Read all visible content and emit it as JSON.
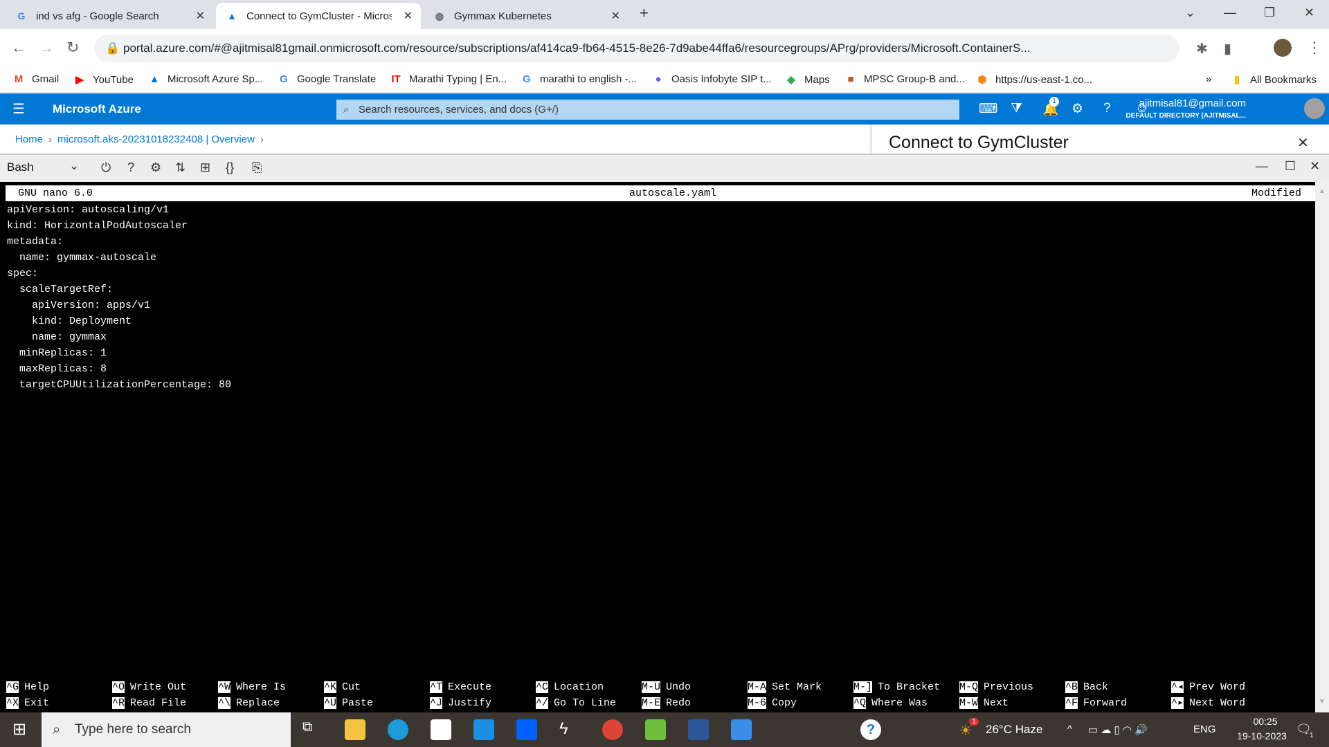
{
  "browser": {
    "tabs": [
      {
        "label": "ind vs afg - Google Search",
        "icon": "google-icon"
      },
      {
        "label": "Connect to GymCluster - Microso",
        "icon": "azure-icon"
      },
      {
        "label": "Gymmax Kubernetes",
        "icon": "globe-icon"
      }
    ],
    "url": "portal.azure.com/#@ajitmisal81gmail.onmicrosoft.com/resource/subscriptions/af414ca9-fb64-4515-8e26-7d9abe44ffa6/resourcegroups/APrg/providers/Microsoft.ContainerS...",
    "bookmarks": [
      "Gmail",
      "YouTube",
      "Microsoft Azure Sp...",
      "Google Translate",
      "Marathi Typing | En...",
      "marathi to english -...",
      "Oasis Infobyte SIP t...",
      "Maps",
      "MPSC Group-B and...",
      "https://us-east-1.co..."
    ],
    "all_bookmarks": "All Bookmarks"
  },
  "azure": {
    "brand": "Microsoft Azure",
    "search_placeholder": "Search resources, services, and docs (G+/)",
    "notification_count": "1",
    "user_email": "ajitmisal81@gmail.com",
    "directory": "DEFAULT DIRECTORY (AJITMISAL...",
    "breadcrumb": [
      "Home",
      "microsoft.aks-20231018232408 | Overview"
    ],
    "panel_title": "Connect to GymCluster",
    "brand_color": "#0078d4"
  },
  "shell": {
    "type": "Bash"
  },
  "nano": {
    "version": "GNU nano 6.0",
    "filename": "autoscale.yaml",
    "status": "Modified",
    "lines": [
      "apiVersion: autoscaling/v1",
      "kind: HorizontalPodAutoscaler",
      "metadata:",
      "  name: gymmax-autoscale",
      "spec:",
      "  scaleTargetRef:",
      "    apiVersion: apps/v1",
      "    kind: Deployment",
      "    name: gymmax",
      "  minReplicas: 1",
      "  maxReplicas: 8",
      "  targetCPUUtilizationPercentage: 80"
    ],
    "shortcuts": [
      [
        {
          "k": "^G",
          "l": "Help"
        },
        {
          "k": "^X",
          "l": "Exit"
        }
      ],
      [
        {
          "k": "^O",
          "l": "Write Out"
        },
        {
          "k": "^R",
          "l": "Read File"
        }
      ],
      [
        {
          "k": "^W",
          "l": "Where Is"
        },
        {
          "k": "^\\",
          "l": "Replace"
        }
      ],
      [
        {
          "k": "^K",
          "l": "Cut"
        },
        {
          "k": "^U",
          "l": "Paste"
        }
      ],
      [
        {
          "k": "^T",
          "l": "Execute"
        },
        {
          "k": "^J",
          "l": "Justify"
        }
      ],
      [
        {
          "k": "^C",
          "l": "Location"
        },
        {
          "k": "^/",
          "l": "Go To Line"
        }
      ],
      [
        {
          "k": "M-U",
          "l": "Undo"
        },
        {
          "k": "M-E",
          "l": "Redo"
        }
      ],
      [
        {
          "k": "M-A",
          "l": "Set Mark"
        },
        {
          "k": "M-6",
          "l": "Copy"
        }
      ],
      [
        {
          "k": "M-]",
          "l": "To Bracket"
        },
        {
          "k": "^Q",
          "l": "Where Was"
        }
      ],
      [
        {
          "k": "M-Q",
          "l": "Previous"
        },
        {
          "k": "M-W",
          "l": "Next"
        }
      ],
      [
        {
          "k": "^B",
          "l": "Back"
        },
        {
          "k": "^F",
          "l": "Forward"
        }
      ],
      [
        {
          "k": "^◂",
          "l": "Prev Word"
        },
        {
          "k": "^▸",
          "l": "Next Word"
        }
      ]
    ]
  },
  "taskbar": {
    "search_placeholder": "Type here to search",
    "weather": "26°C  Haze",
    "weather_badge": "1",
    "lang": "ENG",
    "time": "00:25",
    "date": "19-10-2023",
    "notif": "1"
  }
}
